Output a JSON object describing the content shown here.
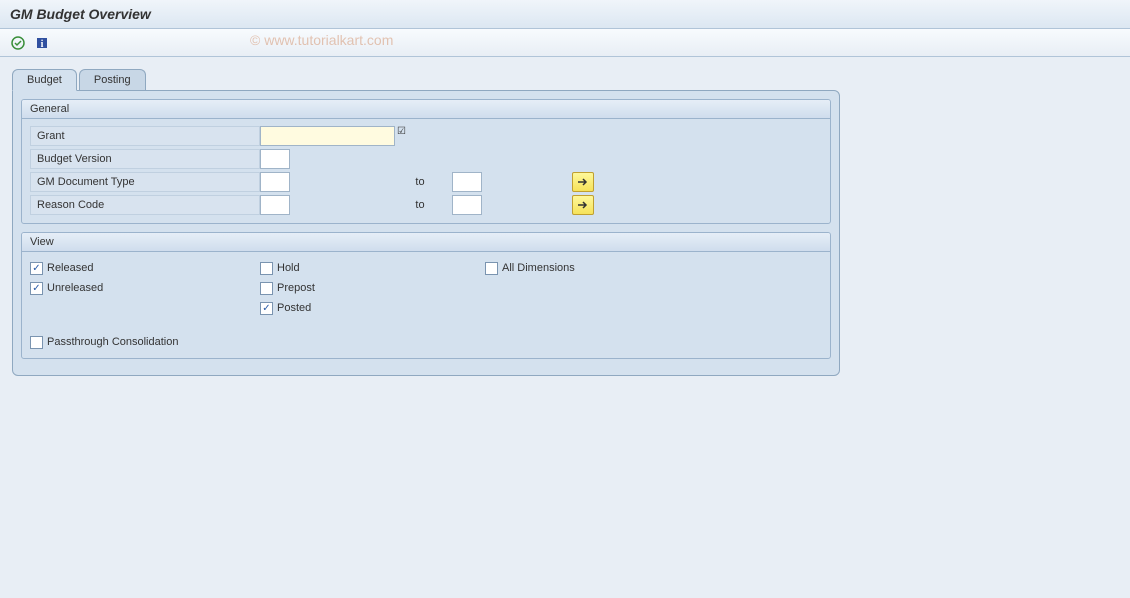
{
  "title": "GM Budget Overview",
  "watermark": "© www.tutorialkart.com",
  "tabs": {
    "budget": "Budget",
    "posting": "Posting"
  },
  "groups": {
    "general": {
      "title": "General",
      "grant_label": "Grant",
      "grant_value": "",
      "budget_version_label": "Budget Version",
      "budget_version_value": "",
      "doc_type_label": "GM Document Type",
      "doc_type_from": "",
      "doc_type_to": "",
      "reason_code_label": "Reason Code",
      "reason_code_from": "",
      "reason_code_to": "",
      "to_label": "to"
    },
    "view": {
      "title": "View",
      "released": "Released",
      "unreleased": "Unreleased",
      "hold": "Hold",
      "prepost": "Prepost",
      "posted": "Posted",
      "all_dimensions": "All Dimensions",
      "passthrough": "Passthrough Consolidation",
      "checked": {
        "released": true,
        "unreleased": true,
        "hold": false,
        "prepost": false,
        "posted": true,
        "all_dimensions": false,
        "passthrough": false
      }
    }
  }
}
